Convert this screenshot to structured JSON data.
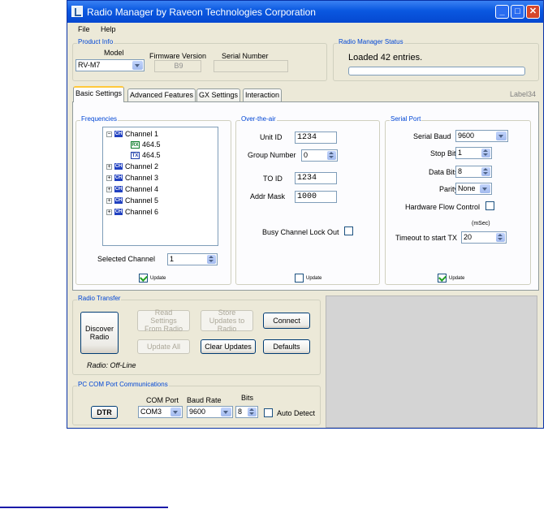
{
  "window": {
    "title": "Radio Manager   by Raveon Technologies Corporation",
    "controls": {
      "minimize": "_",
      "maximize": "□",
      "close": "✕"
    }
  },
  "menu": {
    "file": "File",
    "help": "Help"
  },
  "product_info": {
    "title": "Product Info",
    "model_label": "Model",
    "model_value": "RV-M7",
    "firmware_label": "Firmware Version",
    "firmware_value": "B9",
    "serial_label": "Serial Number",
    "serial_value": ""
  },
  "status": {
    "title": "Radio Manager Status",
    "text": "Loaded  42 entries.",
    "progress": 0
  },
  "tabs": [
    "Basic Settings",
    "Advanced Features",
    "GX Settings",
    "Interaction"
  ],
  "corner_label": "Label34",
  "frequencies": {
    "title": "Frequencies",
    "tree": [
      {
        "expander": "−",
        "icon": "CH",
        "label": "Channel  1"
      },
      {
        "icon": "RX",
        "label": "464.5"
      },
      {
        "icon": "TX",
        "label": "464.5"
      },
      {
        "expander": "+",
        "icon": "CH",
        "label": "Channel  2"
      },
      {
        "expander": "+",
        "icon": "CH",
        "label": "Channel  3"
      },
      {
        "expander": "+",
        "icon": "CH",
        "label": "Channel  4"
      },
      {
        "expander": "+",
        "icon": "CH",
        "label": "Channel  5"
      },
      {
        "expander": "+",
        "icon": "CH",
        "label": "Channel  6"
      }
    ],
    "selected_label": "Selected Channel",
    "selected_value": "1",
    "update_label": "Update",
    "update_checked": true
  },
  "ota": {
    "title": "Over-the-air",
    "unit_id_label": "Unit ID",
    "unit_id_value": "1234",
    "group_label": "Group Number",
    "group_value": "0",
    "to_id_label": "TO ID",
    "to_id_value": "1234",
    "addr_mask_label": "Addr Mask",
    "addr_mask_value": "1000",
    "busy_label": "Busy Channel Lock Out",
    "busy_checked": false,
    "update_label": "Update",
    "update_checked": false
  },
  "serial_port": {
    "title": "Serial Port",
    "baud_label": "Serial Baud",
    "baud_value": "9600",
    "stop_label": "Stop Bits",
    "stop_value": "1",
    "data_label": "Data Bits",
    "data_value": "8",
    "parity_label": "Parity",
    "parity_value": "None",
    "hw_flow_label": "Hardware Flow Control",
    "hw_flow_checked": false,
    "msec_label": "(mSec)",
    "timeout_label": "Timeout to start TX",
    "timeout_value": "20",
    "update_label": "Update",
    "update_checked": true
  },
  "radio_transfer": {
    "title": "Radio Transfer",
    "discover": "Discover Radio",
    "read": "Read Settings From Radio",
    "store": "Store Updates to Radio",
    "connect": "Connect",
    "update_all": "Update All",
    "clear": "Clear Updates",
    "defaults": "Defaults",
    "radio_status": "Radio: Off-Line"
  },
  "com": {
    "title": "PC COM Port Communications",
    "dtr": "DTR",
    "port_label": "COM Port",
    "port_value": "COM3",
    "baud_label": "Baud Rate",
    "baud_value": "9600",
    "bits_label": "Bits",
    "bits_value": "8",
    "auto_label": "Auto Detect",
    "auto_checked": false
  }
}
